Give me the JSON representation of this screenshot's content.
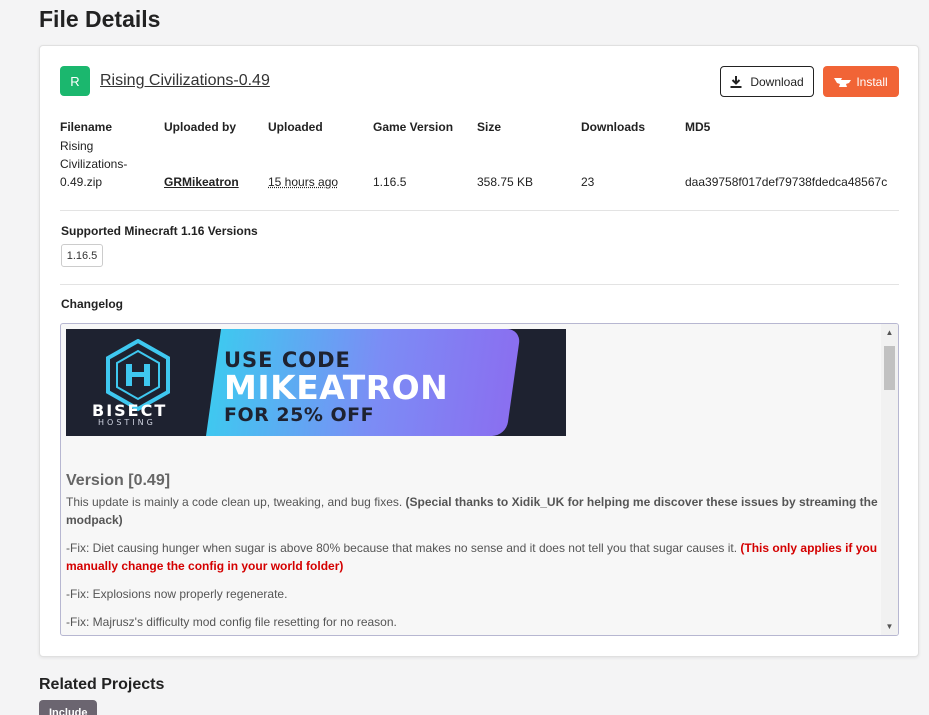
{
  "page": {
    "title": "File Details"
  },
  "file": {
    "avatar_letter": "R",
    "name": "Rising Civilizations-0.49",
    "download_label": "Download",
    "install_label": "Install"
  },
  "meta": {
    "filename": {
      "label": "Filename",
      "lines": [
        "Rising",
        "Civilizations-",
        "0.49.zip"
      ]
    },
    "uploaded_by": {
      "label": "Uploaded by",
      "value": "GRMikeatron"
    },
    "uploaded": {
      "label": "Uploaded",
      "value": "15 hours ago"
    },
    "game_version": {
      "label": "Game Version",
      "value": "1.16.5"
    },
    "size": {
      "label": "Size",
      "value": "358.75 KB"
    },
    "downloads": {
      "label": "Downloads",
      "value": "23"
    },
    "md5": {
      "label": "MD5",
      "value": "daa39758f017def79738fdedca48567c"
    }
  },
  "supported": {
    "label": "Supported Minecraft 1.16 Versions",
    "versions": [
      "1.16.5"
    ]
  },
  "changelog": {
    "label": "Changelog",
    "banner": {
      "line1": "USE CODE",
      "line2": "MIKEATRON",
      "line3": "FOR 25% OFF",
      "brand": "BISECT",
      "brand_sub": "HOSTING"
    },
    "version_heading": "Version [0.49]",
    "p1_plain": "This update is mainly a code clean up, tweaking, and bug fixes. ",
    "p1_bold": "(Special thanks to Xidik_UK for helping me discover these issues by streaming the modpack)",
    "p2_plain": "-Fix: Diet causing hunger when sugar is above 80% because that makes no sense and it does not tell you that sugar causes it. ",
    "p2_red": "(This only applies if you manually change the config in your world folder)",
    "p3": "-Fix: Explosions now properly regenerate.",
    "p4": "-Fix: Majrusz's difficulty mod config file resetting for no reason."
  },
  "related": {
    "title": "Related Projects",
    "tag": "Include"
  },
  "colors": {
    "accent_green": "#1bb76e",
    "install_orange": "#f16436",
    "changelog_red": "#d40000"
  }
}
